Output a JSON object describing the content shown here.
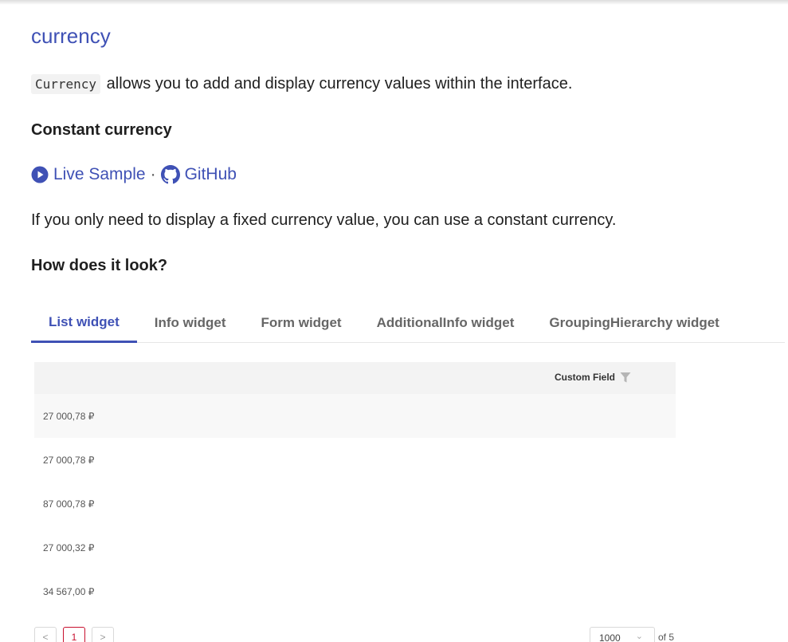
{
  "page": {
    "title": "currency",
    "intro_code": "Currency",
    "intro_text": "allows you to add and display currency values within the interface.",
    "section1_heading": "Constant currency",
    "live_sample_label": "Live Sample",
    "separator": "·",
    "github_label": "GitHub",
    "section1_text": "If you only need to display a fixed currency value, you can use a constant currency.",
    "section2_heading": "How does it look?"
  },
  "tabs": [
    {
      "label": "List widget",
      "active": true
    },
    {
      "label": "Info widget",
      "active": false
    },
    {
      "label": "Form widget",
      "active": false
    },
    {
      "label": "AdditionalInfo widget",
      "active": false
    },
    {
      "label": "GroupingHierarchy widget",
      "active": false
    }
  ],
  "grid": {
    "column_header": "Custom Field",
    "rows": [
      "27 000,78 ₽",
      "27 000,78 ₽",
      "87 000,78 ₽",
      "27 000,32 ₽",
      "34 567,00 ₽"
    ]
  },
  "pagination": {
    "prev": "<",
    "current_page": "1",
    "next": ">",
    "page_size": "1000",
    "total": "of 5"
  },
  "colors": {
    "accent": "#3f51b5",
    "pager_active": "#c8102e"
  },
  "icons": {
    "live_sample": "play-circle-icon",
    "github": "github-icon",
    "filter": "filter-icon",
    "page_size_dropdown": "chevron-down-icon"
  }
}
